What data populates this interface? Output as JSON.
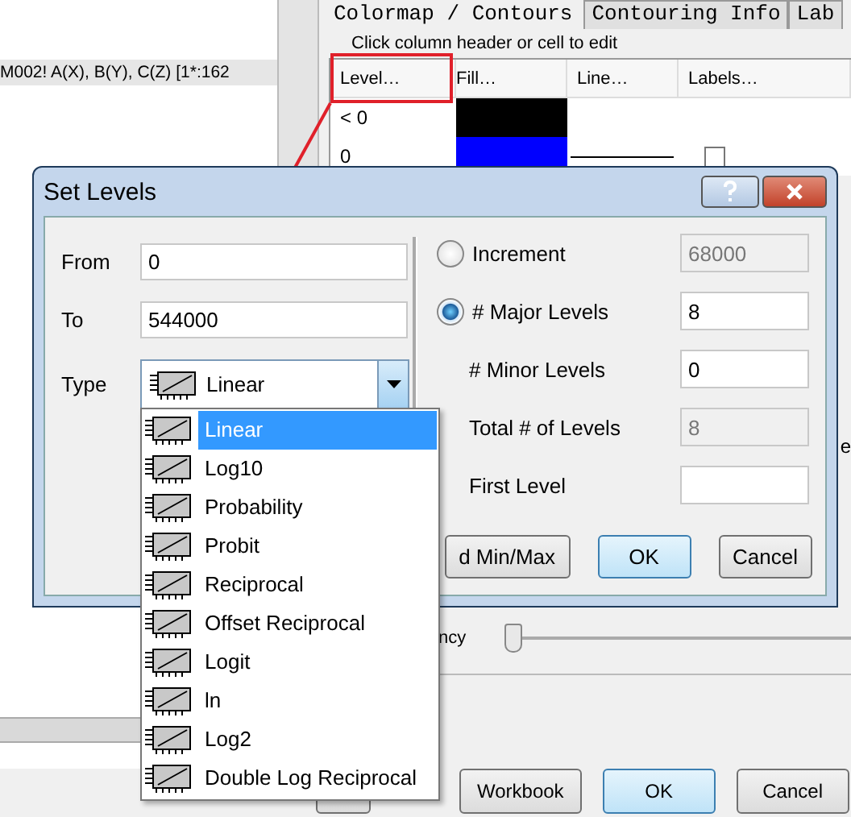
{
  "source_panel": {
    "range_text": "M002! A(X), B(Y), C(Z) [1*:162"
  },
  "tabs": [
    {
      "label": "Colormap / Contours",
      "selected": true
    },
    {
      "label": "Contouring Info",
      "selected": false
    },
    {
      "label": "Lab",
      "selected": false
    }
  ],
  "hint": "Click column header or cell to edit",
  "levels_table": {
    "columns": [
      "Level…",
      "Fill…",
      "Line…",
      "Labels…"
    ],
    "rows": [
      {
        "kind": "underflow",
        "level": "< 0",
        "color": "#000000"
      },
      {
        "kind": "level",
        "level": "0",
        "color": "#0000ff",
        "checked": false
      }
    ]
  },
  "transparency": {
    "label": "ncy",
    "level": 0
  },
  "edge_text": "e",
  "footer_buttons": [
    {
      "kind": "partial"
    },
    {
      "kind": "button",
      "label": "Workbook",
      "default": false
    },
    {
      "kind": "button",
      "label": "OK",
      "default": true
    },
    {
      "kind": "button",
      "label": "Cancel",
      "default": false
    }
  ],
  "dialog": {
    "title": "Set Levels",
    "fields": [
      {
        "label": "From",
        "value": "0"
      },
      {
        "label": "To",
        "value": "544000"
      }
    ],
    "type": {
      "label": "Type",
      "value": "Linear"
    },
    "params": [
      {
        "kind": "radio",
        "label": "Increment",
        "selected": false,
        "value": "68000",
        "disabled": true
      },
      {
        "kind": "radio",
        "label": "# Major Levels",
        "selected": true,
        "value": "8",
        "disabled": false
      },
      {
        "kind": "field",
        "label": "# Minor Levels",
        "value": "0",
        "disabled": false
      },
      {
        "kind": "field",
        "label": "Total # of Levels",
        "value": "8",
        "disabled": true
      },
      {
        "kind": "field",
        "label": "First Level",
        "disabled": false
      }
    ],
    "buttons": [
      {
        "label": "d Min/Max",
        "default": false
      },
      {
        "label": "OK",
        "default": true
      },
      {
        "label": "Cancel",
        "default": false
      }
    ]
  },
  "dropdown": {
    "items": [
      {
        "label": "Linear",
        "selected": true
      },
      {
        "label": "Log10",
        "selected": false
      },
      {
        "label": "Probability",
        "selected": false
      },
      {
        "label": "Probit",
        "selected": false
      },
      {
        "label": "Reciprocal",
        "selected": false
      },
      {
        "label": "Offset Reciprocal",
        "selected": false
      },
      {
        "label": "Logit",
        "selected": false
      },
      {
        "label": "ln",
        "selected": false
      },
      {
        "label": "Log2",
        "selected": false
      },
      {
        "label": "Double Log Reciprocal",
        "selected": false
      }
    ]
  }
}
